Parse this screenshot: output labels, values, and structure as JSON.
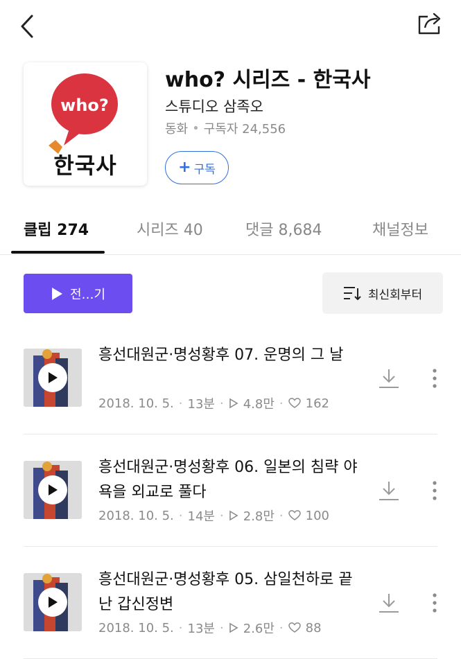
{
  "channel": {
    "title": "who? 시리즈 - 한국사",
    "owner": "스튜디오 삼족오",
    "category": "동화",
    "subscribers_label": "구독자 24,556",
    "subscribe_label": "구독",
    "thumb_bubble_text": "who?",
    "thumb_caption": "한국사"
  },
  "tabs": [
    {
      "label": "클립 274",
      "active": true
    },
    {
      "label": "시리즈 40",
      "active": false
    },
    {
      "label": "댓글 8,684",
      "active": false
    },
    {
      "label": "채널정보",
      "active": false
    }
  ],
  "controls": {
    "play_all_label": "전…기",
    "sort_label": "최신회부터"
  },
  "clips": [
    {
      "title": "흥선대원군·명성황후 07. 운명의 그 날",
      "date": "2018. 10. 5.",
      "duration": "13분",
      "plays": "4.8만",
      "likes": "162"
    },
    {
      "title": "흥선대원군·명성황후 06. 일본의 침략 야욕을 외교로 풀다",
      "date": "2018. 10. 5.",
      "duration": "14분",
      "plays": "2.8만",
      "likes": "100"
    },
    {
      "title": "흥선대원군·명성황후 05. 삼일천하로 끝난 갑신정변",
      "date": "2018. 10. 5.",
      "duration": "13분",
      "plays": "2.6만",
      "likes": "88"
    }
  ],
  "colors": {
    "accent": "#6b4df0",
    "subscribe": "#2f6fe0",
    "bubble": "#d9343f",
    "meta_text": "#8a8a8a"
  },
  "icons": {
    "back": "chevron-left-icon",
    "share": "share-icon",
    "plus": "plus-icon",
    "play": "play-icon",
    "sort": "sort-icon",
    "download": "download-icon",
    "more": "more-vertical-icon",
    "plays": "play-outline-icon",
    "likes": "heart-icon"
  }
}
